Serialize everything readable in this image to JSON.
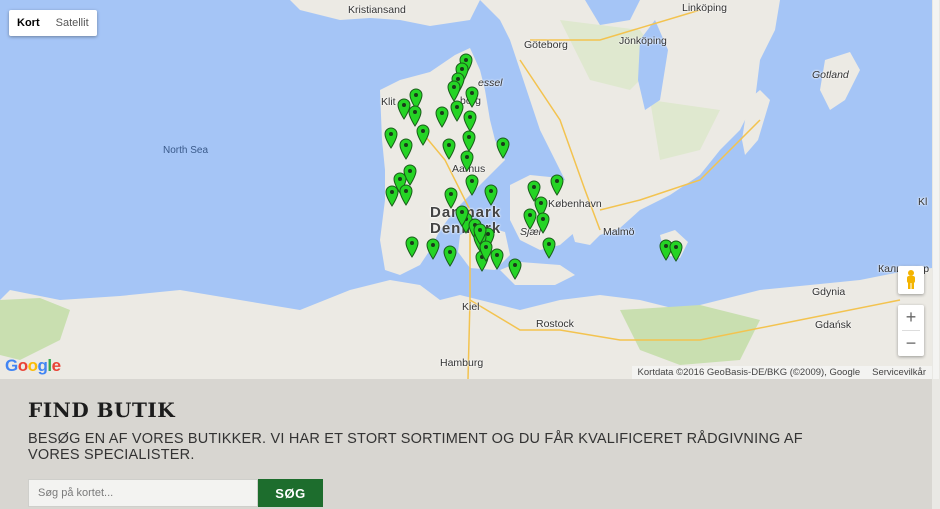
{
  "map": {
    "map_type": {
      "kort_label": "Kort",
      "satellit_label": "Satellit",
      "selected": "Kort"
    },
    "labels": {
      "kristiansand": "Kristiansand",
      "linkoping": "Linköping",
      "goteborg": "Göteborg",
      "jonkoping": "Jönköping",
      "gotland": "Gotland",
      "skaw": "essel",
      "klit": "Klit",
      "north_sea": "North Sea",
      "aarhus": "Aarhus",
      "danmark": "Danmark",
      "denmark": "Denmark",
      "sjaelland": "Sjæl",
      "kobenhavn": "København",
      "malmo": "Malmö",
      "kiel": "Kiel",
      "rostock": "Rostock",
      "gdynia": "Gdynia",
      "gdansk": "Gdańsk",
      "kaliningrad": "Калинингр",
      "hamburg": "Hamburg",
      "kl": "Kl",
      "borg": "borg"
    },
    "google_logo": "Google",
    "attribution": "Kortdata ©2016 GeoBasis-DE/BKG (©2009), Google",
    "terms": "Servicevilkår",
    "zoom_in": "+",
    "zoom_out": "−",
    "pin_color": "#25d425",
    "pin_count": 60
  },
  "store_finder": {
    "title": "FIND BUTIK",
    "subtitle": "BESØG EN AF VORES BUTIKKER. VI HAR ET STORT SORTIMENT OG DU FÅR KVALIFICERET RÅDGIVNING AF VORES SPECIALISTER.",
    "search_placeholder": "Søg på kortet...",
    "search_button": "SØG",
    "button_color": "#1d6d2d"
  }
}
